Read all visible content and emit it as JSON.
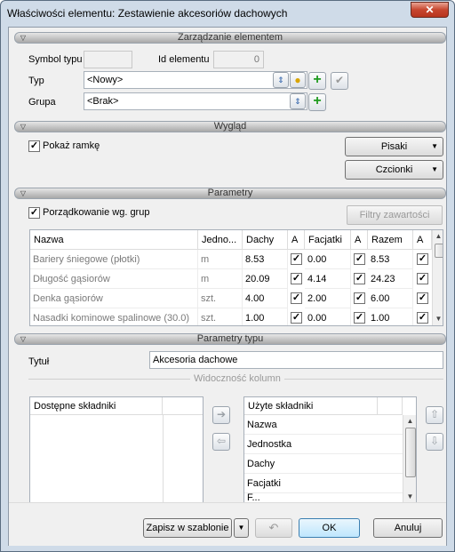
{
  "window": {
    "title": "Właściwości elementu: Zestawienie akcesoriów dachowych",
    "close": "✕"
  },
  "sections": {
    "manage": "Zarządzanie elementem",
    "look": "Wygląd",
    "params": "Parametry",
    "type_params": "Parametry typu"
  },
  "manage": {
    "symbol_label": "Symbol typu",
    "symbol_value": "",
    "id_label": "Id elementu",
    "id_value": "0",
    "typ_label": "Typ",
    "typ_value": "<Nowy>",
    "grupa_label": "Grupa",
    "grupa_value": "<Brak>"
  },
  "look": {
    "show_frame_label": "Pokaż ramkę",
    "show_frame_checked": true,
    "pens_label": "Pisaki",
    "fonts_label": "Czcionki"
  },
  "params": {
    "sort_label": "Porządkowanie wg. grup",
    "sort_checked": true,
    "filter_label": "Filtry zawartości",
    "columns": [
      "Nazwa",
      "Jedno...",
      "Dachy",
      "A",
      "Facjatki",
      "A",
      "Razem",
      "A"
    ],
    "rows": [
      {
        "name": "Bariery śniegowe (płotki)",
        "unit": "m",
        "dachy": "8.53",
        "facjatki": "0.00",
        "razem": "8.53"
      },
      {
        "name": "Długość gąsiorów",
        "unit": "m",
        "dachy": "20.09",
        "facjatki": "4.14",
        "razem": "24.23"
      },
      {
        "name": "Denka gąsiorów",
        "unit": "szt.",
        "dachy": "4.00",
        "facjatki": "2.00",
        "razem": "6.00"
      },
      {
        "name": "Nasadki kominowe spalinowe (30.0)",
        "unit": "szt.",
        "dachy": "1.00",
        "facjatki": "0.00",
        "razem": "1.00"
      }
    ]
  },
  "type_params": {
    "title_label": "Tytuł",
    "title_value": "Akcesoria dachowe",
    "visibility_label": "Widoczność kolumn",
    "available_header": "Dostępne składniki",
    "used_header": "Użyte składniki",
    "used_items": [
      "Nazwa",
      "Jednostka",
      "Dachy",
      "Facjatki",
      "F..."
    ]
  },
  "footer": {
    "save_template": "Zapisz w szablonie",
    "ok": "OK",
    "cancel": "Anuluj"
  }
}
